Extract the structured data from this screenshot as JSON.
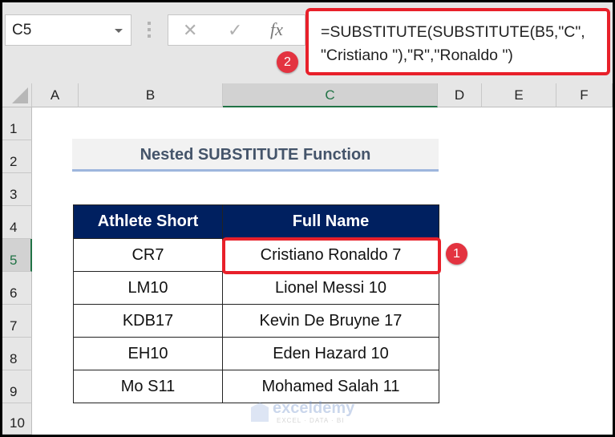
{
  "formula_bar": {
    "name_box": "C5",
    "cancel_icon": "✕",
    "enter_icon": "✓",
    "fx_label": "fx",
    "formula": "=SUBSTITUTE(SUBSTITUTE(B5,\"C\",\n\"Cristiano \"),\"R\",\"Ronaldo \")"
  },
  "annotations": {
    "badge1": "1",
    "badge2": "2"
  },
  "columns": [
    "A",
    "B",
    "C",
    "D",
    "E",
    "F"
  ],
  "selected_column": "C",
  "rows": [
    "1",
    "2",
    "3",
    "4",
    "5",
    "6",
    "7",
    "8",
    "9",
    "10"
  ],
  "selected_row": "5",
  "sheet": {
    "title": "Nested SUBSTITUTE Function",
    "table": {
      "headers": [
        "Athlete Short",
        "Full Name"
      ],
      "rows": [
        [
          "CR7",
          "Cristiano Ronaldo 7"
        ],
        [
          "LM10",
          "Lionel Messi 10"
        ],
        [
          "KDB17",
          "Kevin De Bruyne 17"
        ],
        [
          "EH10",
          "Eden Hazard 10"
        ],
        [
          "Mo S11",
          "Mohamed  Salah 11"
        ]
      ]
    }
  },
  "watermark": {
    "name": "exceldemy",
    "tagline": "EXCEL · DATA · BI"
  },
  "colors": {
    "header_bg": "#002060",
    "highlight": "#e8202a",
    "title_text": "#44546a",
    "excel_green": "#217346"
  }
}
